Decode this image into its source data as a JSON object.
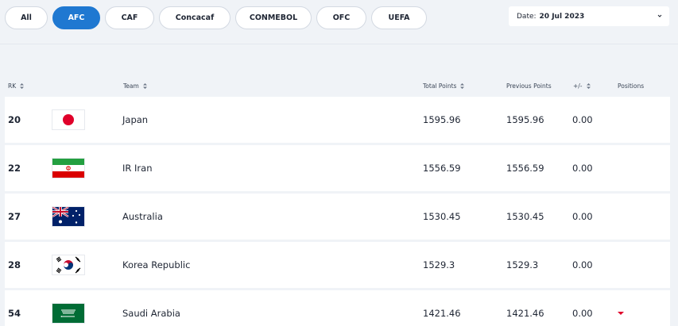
{
  "filters": {
    "confederations": [
      {
        "label": "All",
        "active": false
      },
      {
        "label": "AFC",
        "active": true
      },
      {
        "label": "CAF",
        "active": false
      },
      {
        "label": "Concacaf",
        "active": false
      },
      {
        "label": "CONMEBOL",
        "active": false
      },
      {
        "label": "OFC",
        "active": false
      },
      {
        "label": "UEFA",
        "active": false
      }
    ],
    "date": {
      "prefix": "Date:",
      "value": "20 Jul 2023",
      "icon": "chevron-down-icon"
    }
  },
  "table": {
    "headers": {
      "rank": "RK",
      "team": "Team",
      "total_points": "Total Points",
      "previous_points": "Previous Points",
      "change": "+/-",
      "positions": "Positions"
    },
    "rows": [
      {
        "rank": "20",
        "flag": "japan-flag-icon",
        "team": "Japan",
        "total": "1595.96",
        "previous": "1595.96",
        "change": "0.00",
        "position_trend": "none"
      },
      {
        "rank": "22",
        "flag": "iran-flag-icon",
        "team": "IR Iran",
        "total": "1556.59",
        "previous": "1556.59",
        "change": "0.00",
        "position_trend": "none"
      },
      {
        "rank": "27",
        "flag": "australia-flag-icon",
        "team": "Australia",
        "total": "1530.45",
        "previous": "1530.45",
        "change": "0.00",
        "position_trend": "none"
      },
      {
        "rank": "28",
        "flag": "korea-flag-icon",
        "team": "Korea Republic",
        "total": "1529.3",
        "previous": "1529.3",
        "change": "0.00",
        "position_trend": "none"
      },
      {
        "rank": "54",
        "flag": "saudi-arabia-flag-icon",
        "team": "Saudi Arabia",
        "total": "1421.46",
        "previous": "1421.46",
        "change": "0.00",
        "position_trend": "down"
      }
    ]
  },
  "colors": {
    "accent": "#1f78d1",
    "trend_down": "#e0002a"
  }
}
